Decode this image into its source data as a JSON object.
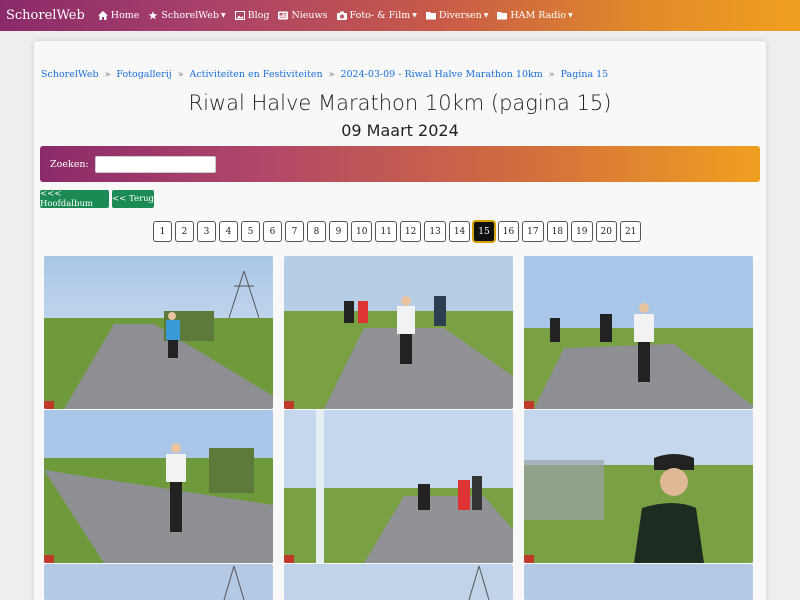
{
  "navbar": {
    "brand": "SchorelWeb",
    "items": [
      {
        "label": "Home",
        "icon": "home-icon",
        "dropdown": false
      },
      {
        "label": "SchorelWeb",
        "icon": "star-icon",
        "dropdown": true
      },
      {
        "label": "Blog",
        "icon": "image-icon",
        "dropdown": false
      },
      {
        "label": "Nieuws",
        "icon": "newspaper-icon",
        "dropdown": false
      },
      {
        "label": "Foto- & Film",
        "icon": "camera-icon",
        "dropdown": true
      },
      {
        "label": "Diversen",
        "icon": "folder-icon",
        "dropdown": true
      },
      {
        "label": "HAM Radio",
        "icon": "folder-icon",
        "dropdown": true
      }
    ]
  },
  "breadcrumb": [
    "SchorelWeb",
    "Fotogallerij",
    "Activiteiten en Festiviteiten",
    "2024-03-09 - Riwal Halve Marathon 10km",
    "Pagina 15"
  ],
  "page": {
    "title": "Riwal Halve Marathon 10km (pagina 15)",
    "subtitle": "09 Maart 2024"
  },
  "search": {
    "label": "Zoeken:",
    "value": ""
  },
  "buttons": {
    "main_album": "<<< Hoofdalbum",
    "back": "<< Terug"
  },
  "pagination": {
    "pages": [
      "1",
      "2",
      "3",
      "4",
      "5",
      "6",
      "7",
      "8",
      "9",
      "10",
      "11",
      "12",
      "13",
      "14",
      "15",
      "16",
      "17",
      "18",
      "19",
      "20",
      "21"
    ],
    "current": "15"
  },
  "colors": {
    "accent_start": "#8a2a6a",
    "accent_end": "#f0a020",
    "button_green": "#1b8a55",
    "link": "#1a6fd8"
  }
}
